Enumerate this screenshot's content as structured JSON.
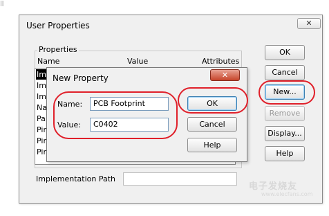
{
  "main_dialog": {
    "title": "User Properties",
    "close_glyph": "✕",
    "properties_group": {
      "legend": "Properties",
      "columns": [
        "Name",
        "Value",
        "Attributes"
      ],
      "row_stubs": [
        "Im",
        "Im",
        "Im",
        "Na",
        "Pa",
        "Pir",
        "Pir",
        "Pir"
      ]
    },
    "implementation_path_label": "Implementation Path",
    "buttons": {
      "ok": "OK",
      "cancel": "Cancel",
      "new": "New...",
      "remove": "Remove",
      "display": "Display...",
      "help": "Help"
    }
  },
  "new_property_dialog": {
    "title": "New Property",
    "close_glyph": "✕",
    "name_label": "Name:",
    "name_value": "PCB Footprint",
    "value_label": "Value:",
    "value_value": "C0402",
    "buttons": {
      "ok": "OK",
      "cancel": "Cancel",
      "help": "Help"
    }
  },
  "watermark": {
    "main": "电子发烧友",
    "sub": "www.elecfans.com"
  },
  "colors": {
    "highlight": "#e0202a",
    "close_red": "#c7452b",
    "default_button_border": "#3c7fb1"
  }
}
